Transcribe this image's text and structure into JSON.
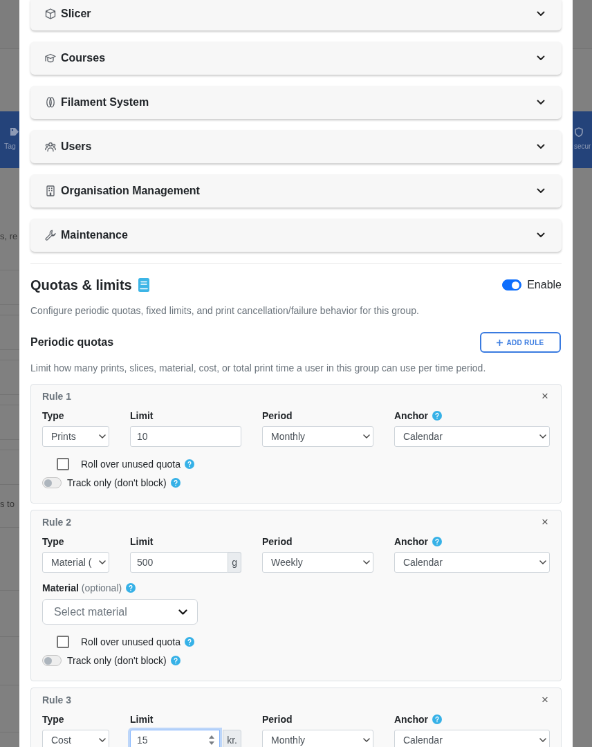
{
  "background": {
    "left_nav_label": "Tag",
    "right_nav_label": "secur",
    "fragments": [
      "s, re",
      "s to"
    ]
  },
  "sections": [
    {
      "title": "Slicer",
      "expanded": false
    },
    {
      "title": "Courses",
      "expanded": false
    },
    {
      "title": "Filament System",
      "expanded": false
    },
    {
      "title": "Users",
      "expanded": false
    },
    {
      "title": "Organisation Management",
      "expanded": false
    },
    {
      "title": "Maintenance",
      "expanded": false
    }
  ],
  "quotas": {
    "title": "Quotas & limits",
    "enabled": true,
    "enable_label": "Enable",
    "description": "Configure periodic quotas, fixed limits, and print cancellation/failure behavior for this group.",
    "periodic": {
      "title": "Periodic quotas",
      "add_button": "ADD RULE",
      "description": "Limit how many prints, slices, material, cost, or total print time a user in this group can use per time period.",
      "rules": [
        {
          "title": "Rule 1",
          "remove": "×",
          "fields": [
            {
              "kind": "select",
              "label": "Type",
              "value": "Prints",
              "help": false,
              "focused": false
            },
            {
              "kind": "number",
              "label": "Limit",
              "value": "10",
              "help": false,
              "focused": false
            },
            {
              "kind": "select",
              "label": "Period",
              "value": "Monthly",
              "help": false,
              "focused": false
            },
            {
              "kind": "select",
              "label": "Anchor",
              "value": "Calendar",
              "help": true,
              "focused": false
            }
          ],
          "rollover": {
            "label": "Roll over unused quota",
            "checked": false,
            "help": true
          },
          "track_only": {
            "label": "Track only (don't block)",
            "on": false,
            "help": true
          }
        },
        {
          "title": "Rule 2",
          "remove": "×",
          "fields": [
            {
              "kind": "select",
              "label": "Type",
              "value": "Material (",
              "help": false,
              "focused": false
            },
            {
              "kind": "number",
              "label": "Limit",
              "value": "500",
              "unit": "g",
              "help": false,
              "focused": false
            },
            {
              "kind": "select",
              "label": "Period",
              "value": "Weekly",
              "help": false,
              "focused": false
            },
            {
              "kind": "select",
              "label": "Anchor",
              "value": "Calendar",
              "help": true,
              "focused": false
            }
          ],
          "material": {
            "label": "**Material** (optional)",
            "help": true,
            "placeholder": "Select material"
          },
          "rollover": {
            "label": "Roll over unused quota",
            "checked": false,
            "help": true
          },
          "track_only": {
            "label": "Track only (don't block)",
            "on": false,
            "help": true
          }
        },
        {
          "title": "Rule 3",
          "remove": "×",
          "fields": [
            {
              "kind": "select",
              "label": "Type",
              "value": "Cost",
              "help": false,
              "focused": false
            },
            {
              "kind": "number",
              "label": "Limit",
              "value": "15",
              "unit": "kr.",
              "help": false,
              "focused": true
            },
            {
              "kind": "select",
              "label": "Period",
              "value": "Monthly",
              "help": false,
              "focused": false
            },
            {
              "kind": "select",
              "label": "Anchor",
              "value": "Calendar",
              "help": true,
              "focused": false
            }
          ]
        }
      ]
    }
  }
}
